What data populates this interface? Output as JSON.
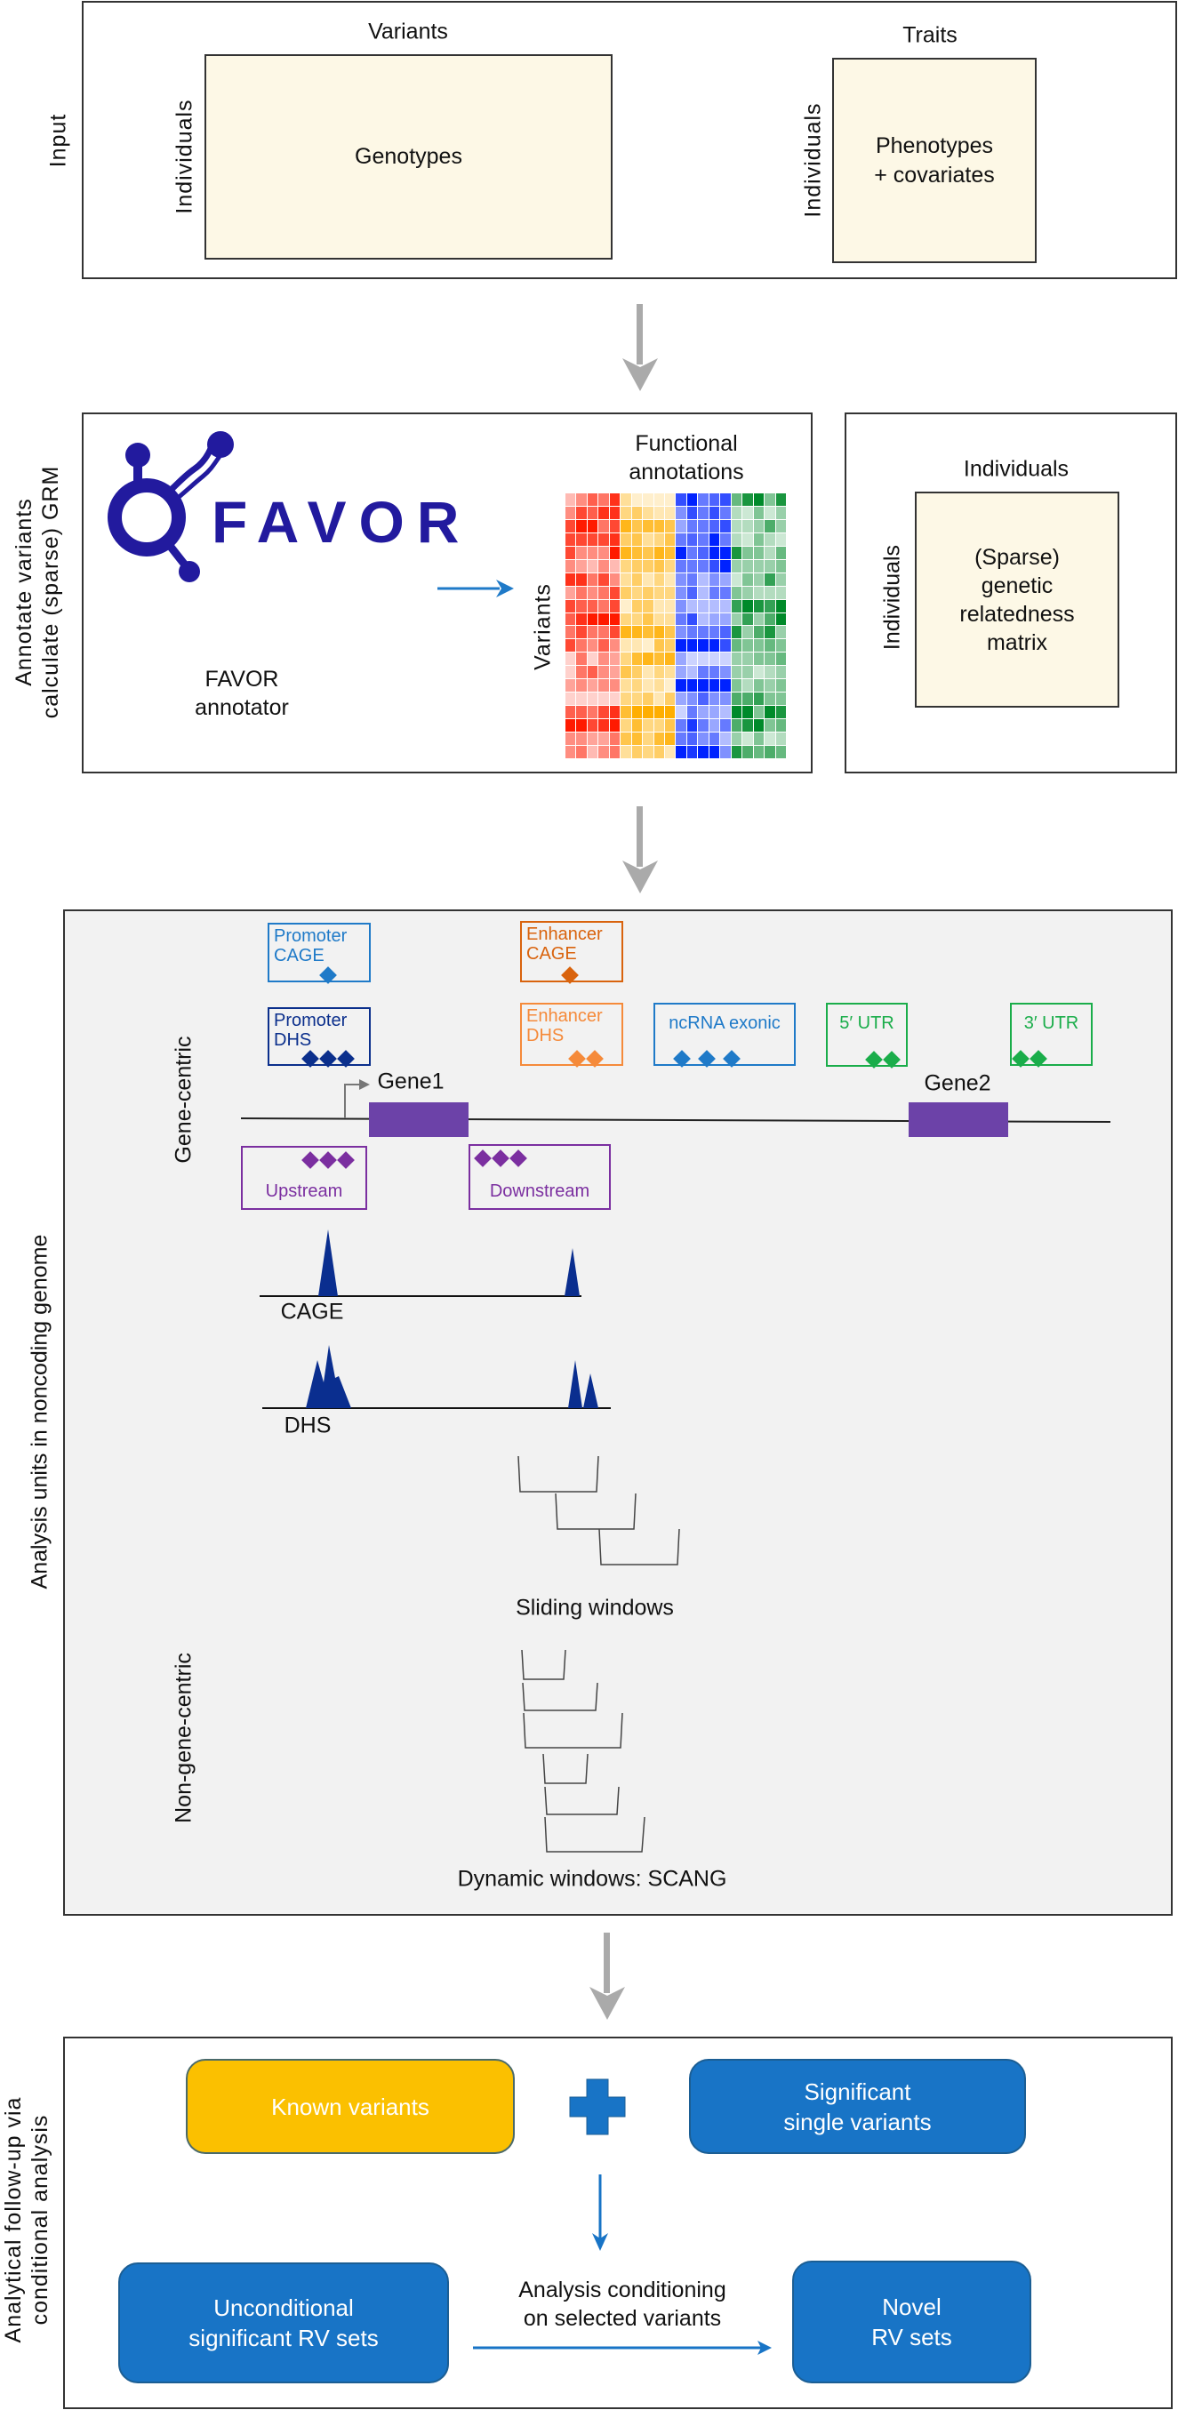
{
  "colors": {
    "cream": "#fdf8e6",
    "favor_blue": "#221a9e",
    "gray_arrow": "#aaaaaa",
    "accent_blue": "#1874c6",
    "known_yellow": "#fbc000",
    "gene_purple": "#6c42a8",
    "peak_navy": "#0a2e8f",
    "panel_gray": "#f2f2f2"
  },
  "input_section": {
    "side_label": "Input",
    "genotypes": {
      "top_label": "Variants",
      "side_label": "Individuals",
      "text": "Genotypes"
    },
    "phenotypes": {
      "top_label": "Traits",
      "side_label": "Individuals",
      "line1": "Phenotypes",
      "line2": "+ covariates"
    }
  },
  "annotate_section": {
    "side_label_line1": "Annotate variants",
    "side_label_line2": "calculate (sparse) GRM",
    "logo_text": "FAVOR",
    "annotator_line1": "FAVOR",
    "annotator_line2": "annotator",
    "heatmap_title_line1": "Functional",
    "heatmap_title_line2": "annotations",
    "heatmap_side_label": "Variants",
    "heatmap": {
      "rows": 20,
      "groups": [
        {
          "name": "red",
          "color": "#ff1a00"
        },
        {
          "name": "orange",
          "color": "#ffae00"
        },
        {
          "name": "blue",
          "color": "#0022ff"
        },
        {
          "name": "green",
          "color": "#008a2a"
        }
      ],
      "intensity": [
        [
          0.3,
          0.5,
          0.7,
          0.6,
          0.9,
          0.4,
          0.2,
          0.2,
          0.2,
          0.2,
          0.8,
          1.0,
          0.6,
          0.7,
          0.8,
          0.6,
          0.9,
          1.0,
          0.5,
          0.9
        ],
        [
          0.5,
          0.8,
          0.7,
          0.9,
          0.9,
          0.5,
          0.6,
          0.4,
          0.3,
          0.3,
          0.5,
          0.8,
          0.6,
          0.8,
          0.6,
          0.3,
          0.2,
          0.5,
          0.2,
          0.4
        ],
        [
          0.8,
          1.0,
          1.0,
          0.6,
          0.8,
          0.9,
          0.7,
          0.8,
          0.8,
          0.7,
          0.4,
          0.6,
          0.6,
          0.7,
          0.8,
          0.3,
          0.3,
          0.4,
          0.7,
          0.4
        ],
        [
          0.8,
          0.8,
          0.8,
          0.8,
          0.9,
          0.6,
          0.7,
          0.4,
          0.5,
          0.7,
          0.6,
          0.7,
          0.6,
          1.0,
          0.6,
          0.3,
          0.2,
          0.5,
          0.3,
          0.2
        ],
        [
          0.8,
          0.5,
          0.5,
          0.5,
          1.0,
          0.9,
          0.8,
          0.7,
          0.9,
          0.8,
          1.0,
          0.6,
          0.7,
          1.0,
          1.0,
          0.9,
          0.5,
          0.5,
          0.3,
          0.6
        ],
        [
          0.5,
          0.4,
          0.3,
          0.5,
          0.3,
          0.5,
          0.6,
          0.6,
          0.7,
          0.5,
          0.6,
          0.6,
          0.6,
          0.8,
          1.0,
          0.4,
          0.4,
          0.4,
          0.4,
          0.5
        ],
        [
          0.9,
          0.9,
          0.6,
          0.8,
          0.5,
          0.4,
          0.6,
          0.3,
          0.5,
          0.3,
          0.5,
          0.6,
          0.3,
          0.5,
          0.4,
          0.2,
          0.5,
          0.4,
          0.8,
          0.4
        ],
        [
          0.4,
          0.6,
          0.5,
          0.6,
          0.8,
          0.6,
          0.5,
          0.6,
          0.5,
          0.5,
          0.5,
          0.7,
          0.3,
          0.6,
          0.6,
          0.5,
          0.4,
          0.3,
          0.3,
          0.3
        ],
        [
          0.8,
          0.7,
          0.7,
          0.6,
          0.8,
          0.2,
          0.6,
          0.6,
          0.3,
          0.3,
          0.5,
          0.3,
          0.3,
          0.3,
          0.3,
          0.8,
          1.0,
          0.9,
          0.8,
          1.0
        ],
        [
          0.7,
          0.9,
          1.0,
          1.0,
          1.0,
          0.5,
          0.5,
          0.7,
          0.4,
          0.4,
          0.6,
          0.8,
          0.3,
          0.4,
          0.4,
          0.4,
          0.8,
          0.4,
          0.7,
          1.0
        ],
        [
          0.6,
          0.8,
          0.6,
          0.6,
          0.8,
          0.9,
          0.9,
          0.8,
          0.9,
          0.7,
          0.5,
          0.6,
          0.6,
          0.6,
          0.7,
          0.9,
          0.4,
          0.7,
          0.9,
          0.4
        ],
        [
          0.8,
          0.6,
          0.5,
          0.7,
          0.5,
          0.3,
          0.3,
          0.2,
          0.7,
          0.6,
          1.0,
          1.0,
          1.0,
          1.0,
          0.8,
          0.6,
          0.5,
          0.5,
          0.6,
          0.5
        ],
        [
          0.2,
          0.6,
          0.2,
          0.5,
          0.4,
          0.5,
          0.8,
          0.9,
          0.8,
          0.9,
          0.4,
          0.2,
          0.2,
          0.2,
          0.2,
          0.4,
          0.4,
          0.5,
          0.5,
          0.6
        ],
        [
          0.2,
          0.6,
          0.7,
          0.5,
          0.4,
          0.7,
          0.6,
          0.3,
          0.5,
          0.4,
          0.4,
          0.3,
          0.6,
          0.6,
          0.5,
          0.4,
          0.4,
          0.2,
          0.3,
          0.4
        ],
        [
          0.4,
          0.5,
          0.4,
          0.5,
          0.5,
          0.4,
          0.5,
          0.3,
          0.4,
          0.2,
          1.0,
          1.0,
          1.0,
          1.0,
          1.0,
          0.5,
          0.3,
          0.5,
          0.4,
          0.5
        ],
        [
          0.2,
          0.2,
          0.2,
          0.2,
          0.2,
          0.5,
          0.5,
          0.6,
          0.3,
          0.6,
          0.4,
          0.5,
          0.7,
          0.5,
          0.5,
          0.7,
          0.7,
          0.8,
          0.5,
          0.5
        ],
        [
          0.7,
          0.7,
          0.6,
          0.8,
          0.9,
          0.8,
          1.0,
          1.0,
          1.0,
          1.0,
          0.2,
          0.6,
          0.4,
          0.4,
          0.3,
          1.0,
          1.0,
          0.5,
          1.0,
          0.9
        ],
        [
          1.0,
          1.0,
          0.8,
          0.9,
          1.0,
          0.5,
          0.8,
          0.5,
          0.5,
          0.7,
          0.6,
          0.9,
          0.6,
          0.4,
          0.6,
          0.7,
          0.9,
          1.0,
          0.5,
          0.6
        ],
        [
          0.5,
          0.5,
          0.4,
          0.4,
          0.6,
          0.7,
          0.8,
          0.5,
          0.8,
          0.9,
          0.6,
          0.7,
          0.5,
          0.6,
          0.3,
          0.4,
          0.2,
          0.5,
          0.2,
          0.3
        ],
        [
          0.5,
          0.6,
          0.3,
          0.5,
          0.6,
          0.4,
          0.6,
          0.5,
          0.6,
          0.3,
          1.0,
          0.9,
          1.0,
          1.0,
          0.5,
          0.9,
          0.7,
          0.6,
          0.7,
          0.6
        ]
      ]
    },
    "grm": {
      "top_label": "Individuals",
      "side_label": "Individuals",
      "line1": "(Sparse)",
      "line2": "genetic",
      "line3": "relatedness",
      "line4": "matrix"
    }
  },
  "analysis_units": {
    "side_label": "Analysis units in noncoding genome",
    "gene_centric_label": "Gene-centric",
    "non_gene_centric_label": "Non-gene-centric",
    "annotations": [
      {
        "id": "promoter-cage",
        "line1": "Promoter",
        "line2": "CAGE",
        "color": "#1f7ac8",
        "diamond_color": "#1f7ac8",
        "diamonds": 1
      },
      {
        "id": "enhancer-cage",
        "line1": "Enhancer",
        "line2": "CAGE",
        "color": "#d9630d",
        "diamond_color": "#d9630d",
        "diamonds": 1
      },
      {
        "id": "promoter-dhs",
        "line1": "Promoter",
        "line2": "DHS",
        "color": "#0b2f8c",
        "diamond_color": "#0b2f8c",
        "diamonds": 3
      },
      {
        "id": "enhancer-dhs",
        "line1": "Enhancer",
        "line2": "DHS",
        "color": "#f58a3a",
        "diamond_color": "#f58a3a",
        "diamonds": 2
      },
      {
        "id": "ncrna-exonic",
        "line1": "ncRNA exonic",
        "line2": "",
        "color": "#1f7ac8",
        "diamond_color": "#1f7ac8",
        "diamonds": 3
      },
      {
        "id": "utr5",
        "line1": "5′ UTR",
        "line2": "",
        "color": "#1aad4a",
        "diamond_color": "#1aad4a",
        "diamonds": 2
      },
      {
        "id": "utr3",
        "line1": "3′ UTR",
        "line2": "",
        "color": "#1aad4a",
        "diamond_color": "#1aad4a",
        "diamonds": 2
      },
      {
        "id": "upstream",
        "line1": "Upstream",
        "line2": "",
        "color": "#7b2fa0",
        "diamond_color": "#7b2fa0",
        "diamonds": 3
      },
      {
        "id": "downstream",
        "line1": "Downstream",
        "line2": "",
        "color": "#7b2fa0",
        "diamond_color": "#7b2fa0",
        "diamonds": 3
      }
    ],
    "gene1_label": "Gene1",
    "gene2_label": "Gene2",
    "cage_label": "CAGE",
    "dhs_label": "DHS",
    "sliding_label": "Sliding windows",
    "dynamic_label": "Dynamic windows: SCANG"
  },
  "followup": {
    "side_label_line1": "Analytical follow-up via",
    "side_label_line2": "conditional analysis",
    "known_variants": "Known variants",
    "significant_line1": "Significant",
    "significant_line2": "single variants",
    "unconditional_line1": "Unconditional",
    "unconditional_line2": "significant RV sets",
    "conditioning_line1": "Analysis conditioning",
    "conditioning_line2": "on selected variants",
    "novel_line1": "Novel",
    "novel_line2": "RV sets"
  }
}
